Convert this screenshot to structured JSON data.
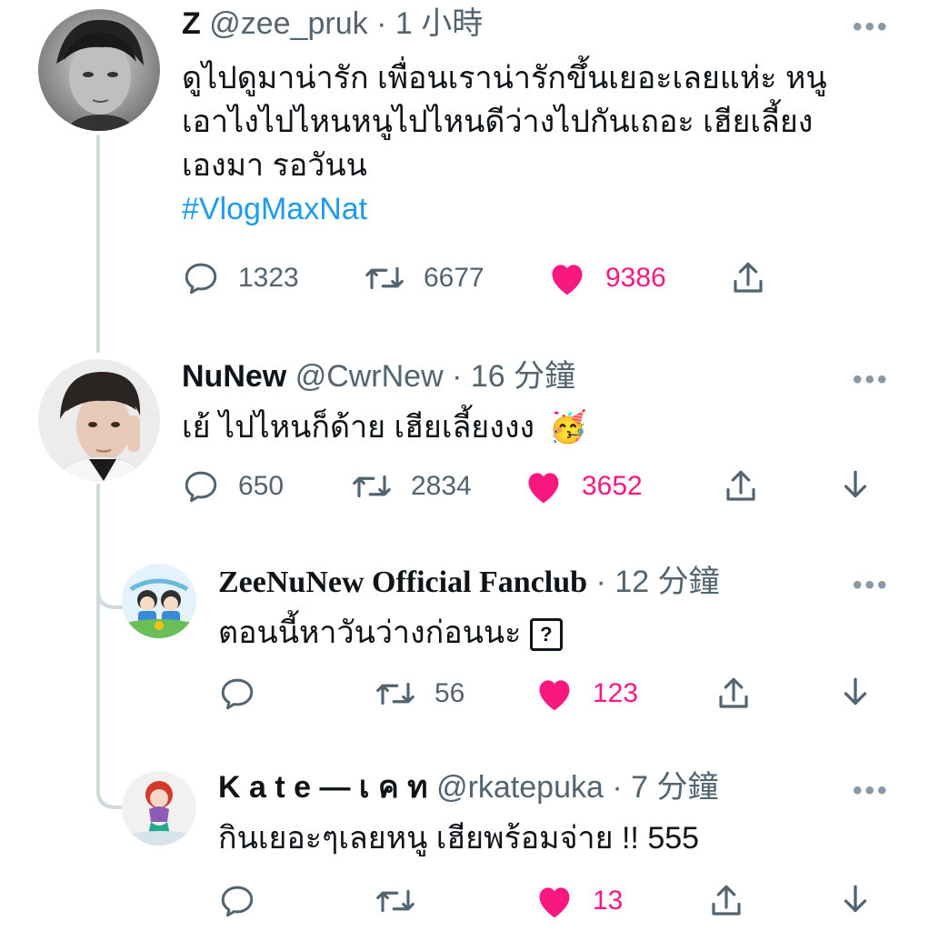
{
  "tweets": [
    {
      "name": "Z",
      "handle": "@zee_pruk",
      "dot": "·",
      "time": "1 小時",
      "lines": [
        "ดูไปดูมาน่ารัก เพื่อนเราน่ารักขึ้นเยอะเลยแห่ะ หนู",
        "เอาไงไปไหนหนูไปไหนดีว่างไปกันเถอะ เฮียเลี้ยง",
        "เองมา รอวันน"
      ],
      "hashtag": "#VlogMaxNat",
      "replies": "1323",
      "retweets": "6677",
      "likes": "9386"
    },
    {
      "name": "NuNew",
      "handle": "@CwrNew",
      "dot": "·",
      "time": "16 分鐘",
      "text": "เย้ ไปไหนก็ด้าย เฮียเลี้ยงงง",
      "emoji": "🥳",
      "replies": "650",
      "retweets": "2834",
      "likes": "3652"
    },
    {
      "name": "ZeeNuNew Official Fanclub",
      "handle": "",
      "dot": "·",
      "time": "12 分鐘",
      "text": "ตอนนี้หาวันว่างก่อนนะ",
      "emoji": "?",
      "replies": "",
      "retweets": "56",
      "likes": "123"
    },
    {
      "name": "K a t e — เ ค ท",
      "handle": "@rkatepuka",
      "dot": "·",
      "time": "7 分鐘",
      "text": "กินเยอะๆเลยหนู เฮียพร้อมจ่าย !! 555",
      "replies": "",
      "retweets": "",
      "likes": "13"
    }
  ],
  "more_glyph": "•••",
  "colors": {
    "like": "#f91880",
    "link": "#1d9bf0",
    "muted": "#536471",
    "thread": "#cfd9de"
  }
}
